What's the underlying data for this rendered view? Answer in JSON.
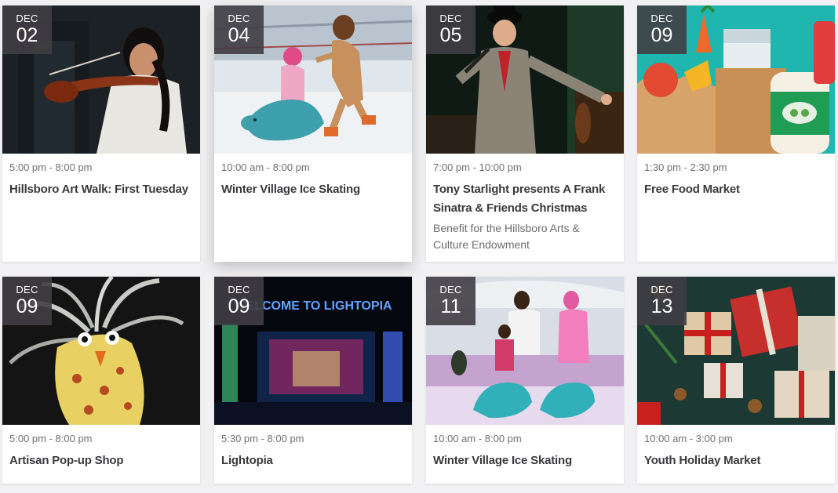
{
  "colors": {
    "badge_bg": "#403e44",
    "title_text": "#3a3a3d",
    "meta_text": "#6f6f73",
    "page_bg": "#f1f1f3"
  },
  "events": [
    {
      "month": "DEC",
      "day": "02",
      "time": "5:00 pm - 8:00 pm",
      "title": "Hillsboro Art Walk: First Tuesday",
      "subtitle": "",
      "image": "violinist-photo"
    },
    {
      "month": "DEC",
      "day": "04",
      "time": "10:00 am - 8:00 pm",
      "title": "Winter Village Ice Skating",
      "subtitle": "",
      "image": "ice-skating-photo"
    },
    {
      "month": "DEC",
      "day": "05",
      "time": "7:00 pm - 10:00 pm",
      "title": "Tony Starlight presents A Frank Sinatra & Friends Christmas",
      "subtitle": "Benefit for the Hillsboro Arts & Culture Endowment",
      "image": "singer-photo"
    },
    {
      "month": "DEC",
      "day": "09",
      "time": "1:30 pm - 2:30 pm",
      "title": "Free Food Market",
      "subtitle": "",
      "image": "groceries-illustration"
    },
    {
      "month": "DEC",
      "day": "09",
      "time": "5:00 pm - 8:00 pm",
      "title": "Artisan Pop-up Shop",
      "subtitle": "",
      "image": "air-plant-sculpture-photo"
    },
    {
      "month": "DEC",
      "day": "09",
      "time": "5:30 pm - 8:00 pm",
      "title": "Lightopia",
      "subtitle": "",
      "image": "lightopia-photo",
      "image_sign": "WELCOME TO LIGHTOPIA"
    },
    {
      "month": "DEC",
      "day": "11",
      "time": "10:00 am - 8:00 pm",
      "title": "Winter Village Ice Skating",
      "subtitle": "",
      "image": "family-skating-photo"
    },
    {
      "month": "DEC",
      "day": "13",
      "time": "10:00 am - 3:00 pm",
      "title": "Youth Holiday Market",
      "subtitle": "",
      "image": "gift-boxes-photo"
    }
  ]
}
